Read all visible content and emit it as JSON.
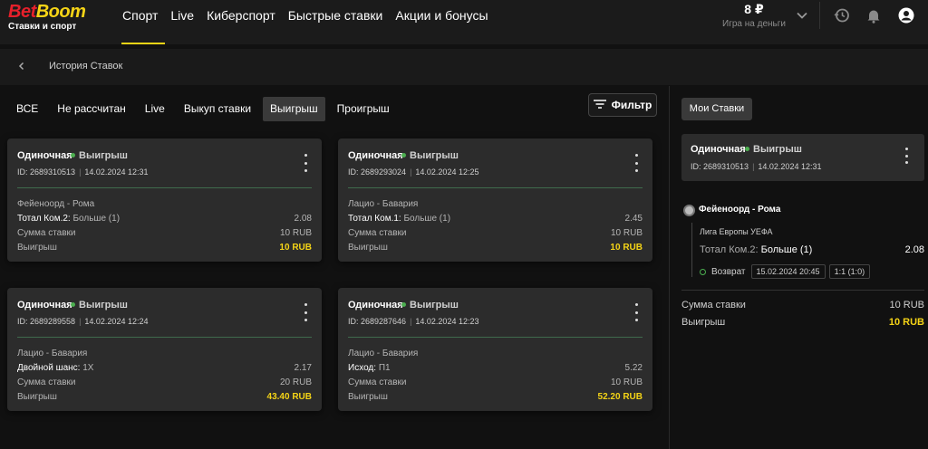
{
  "brand": {
    "bet": "Bet",
    "boom": "Boom",
    "tagline": "Ставки и спорт"
  },
  "nav": [
    "Спорт",
    "Live",
    "Киберспорт",
    "Быстрые ставки",
    "Акции и бонусы"
  ],
  "balance": {
    "amount": "8 ₽",
    "label": "Игра на деньги"
  },
  "header_icons": [
    "chevron-down-icon",
    "history-icon",
    "bell-icon",
    "user-icon"
  ],
  "breadcrumb": {
    "title": "История Ставок"
  },
  "tabs": [
    "ВСЕ",
    "Не рассчитан",
    "Live",
    "Выкуп ставки",
    "Выигрыш",
    "Проигрыш"
  ],
  "active_tab": "Выигрыш",
  "filter_label": "Фильтр",
  "labels": {
    "stake": "Сумма ставки",
    "win": "Выигрыш"
  },
  "cards": [
    {
      "type": "Одиночная",
      "status": "Выигрыш",
      "id": "ID: 2689310513",
      "date": "14.02.2024 12:31",
      "event": "Фейеноорд - Рома",
      "market": "Тотал Ком.2:",
      "pick": "Больше (1)",
      "odds": "2.08",
      "stake": "10 RUB",
      "win": "10 RUB"
    },
    {
      "type": "Одиночная",
      "status": "Выигрыш",
      "id": "ID: 2689293024",
      "date": "14.02.2024 12:25",
      "event": "Лацио - Бавария",
      "market": "Тотал Ком.1:",
      "pick": "Больше (1)",
      "odds": "2.45",
      "stake": "10 RUB",
      "win": "10 RUB"
    },
    {
      "type": "Одиночная",
      "status": "Выигрыш",
      "id": "ID: 2689289558",
      "date": "14.02.2024 12:24",
      "event": "Лацио - Бавария",
      "market": "Двойной шанс:",
      "pick": "1X",
      "odds": "2.17",
      "stake": "20 RUB",
      "win": "43.40 RUB"
    },
    {
      "type": "Одиночная",
      "status": "Выигрыш",
      "id": "ID: 2689287646",
      "date": "14.02.2024 12:23",
      "event": "Лацио - Бавария",
      "market": "Исход:",
      "pick": "П1",
      "odds": "5.22",
      "stake": "10 RUB",
      "win": "52.20 RUB"
    }
  ],
  "detail": {
    "my_bets_label": "Мои Ставки",
    "type": "Одиночная",
    "status": "Выигрыш",
    "id": "ID: 2689310513",
    "date": "14.02.2024 12:31",
    "match": "Фейеноорд - Рома",
    "league": "Лига Европы УЕФА",
    "market": "Тотал Ком.2:",
    "pick": "Больше (1)",
    "odds": "2.08",
    "return_label": "Возврат",
    "return_date": "15.02.2024 20:45",
    "score": "1:1 (1:0)",
    "stake_label": "Сумма ставки",
    "stake": "10 RUB",
    "win_label": "Выигрыш",
    "win": "10 RUB"
  },
  "colors": {
    "accent": "#f5d416",
    "brand_red": "#e6202b",
    "status_green": "#4caf50",
    "card_bg": "#2c2c2c"
  }
}
